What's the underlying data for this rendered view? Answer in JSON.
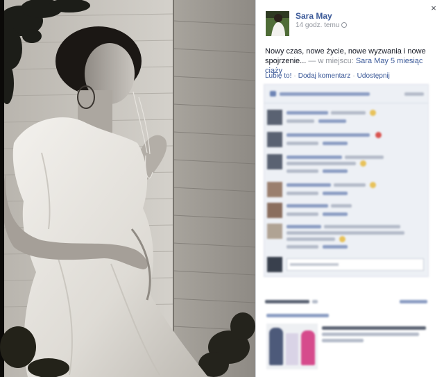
{
  "post": {
    "author": "Sara May",
    "time": "14 godz. temu",
    "text_main": "Nowy czas, nowe życie, nowe wyzwania i nowe spojrzenie...",
    "text_sep": " — w miejscu: ",
    "place": "Sara May 5 miesiąc ciąży"
  },
  "actions": {
    "like": "Lubię to!",
    "dot": "·",
    "comment": "Dodaj komentarz",
    "share": "Udostępnij"
  },
  "viewer": {
    "close_glyph": "×"
  },
  "colors": {
    "link": "#3b5998",
    "comments_bg": "#edf0f5",
    "photo_tone": "#0c0b09"
  },
  "icons": {
    "close": "close-icon",
    "privacy": "globe-icon"
  }
}
